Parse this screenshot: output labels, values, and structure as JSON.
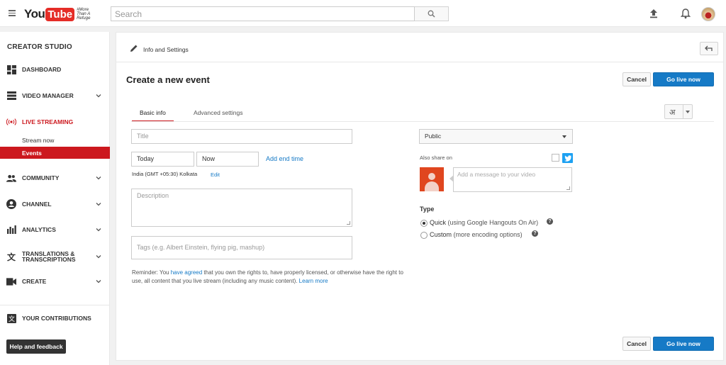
{
  "topbar": {
    "logo_you": "You",
    "logo_tube": "Tube",
    "logo_tagline": "#More Than A Refuge",
    "search_placeholder": "Search"
  },
  "sidebar": {
    "title": "CREATOR STUDIO",
    "items": {
      "dashboard": "DASHBOARD",
      "video_manager": "VIDEO MANAGER",
      "live_streaming": "LIVE STREAMING",
      "stream_now": "Stream now",
      "events": "Events",
      "community": "COMMUNITY",
      "channel": "CHANNEL",
      "analytics": "ANALYTICS",
      "translations_1": "TRANSLATIONS &",
      "translations_2": "TRANSCRIPTIONS",
      "create": "CREATE",
      "your_contributions": "YOUR CONTRIBUTIONS"
    },
    "help_label": "Help and feedback"
  },
  "main": {
    "header_title": "Info and Settings",
    "page_title": "Create a new event",
    "cancel_label": "Cancel",
    "golive_label": "Go live now",
    "tabs": {
      "basic": "Basic info",
      "advanced": "Advanced settings"
    },
    "lang_glyph": "अ",
    "form": {
      "title_placeholder": "Title",
      "date_value": "Today",
      "time_value": "Now",
      "add_end_time": "Add end time",
      "timezone": "India (GMT +05:30) Kolkata",
      "edit": "Edit",
      "description_placeholder": "Description",
      "tags_placeholder": "Tags (e.g. Albert Einstein, flying pig, mashup)"
    },
    "reminder": {
      "part1": "Reminder: You ",
      "link1": "have agreed",
      "part2": " that you own the rights to, have properly licensed, or otherwise have the right to use, all content that you live stream (including any music content). ",
      "link2": "Learn more"
    },
    "privacy_value": "Public",
    "also_share": "Also share on",
    "share_placeholder": "Add a message to your video",
    "type_label": "Type",
    "type_quick": "Quick",
    "type_quick_note": "(using Google Hangouts On Air)",
    "type_custom": "Custom",
    "type_custom_note": "(more encoding options)",
    "help_glyph": "?"
  }
}
